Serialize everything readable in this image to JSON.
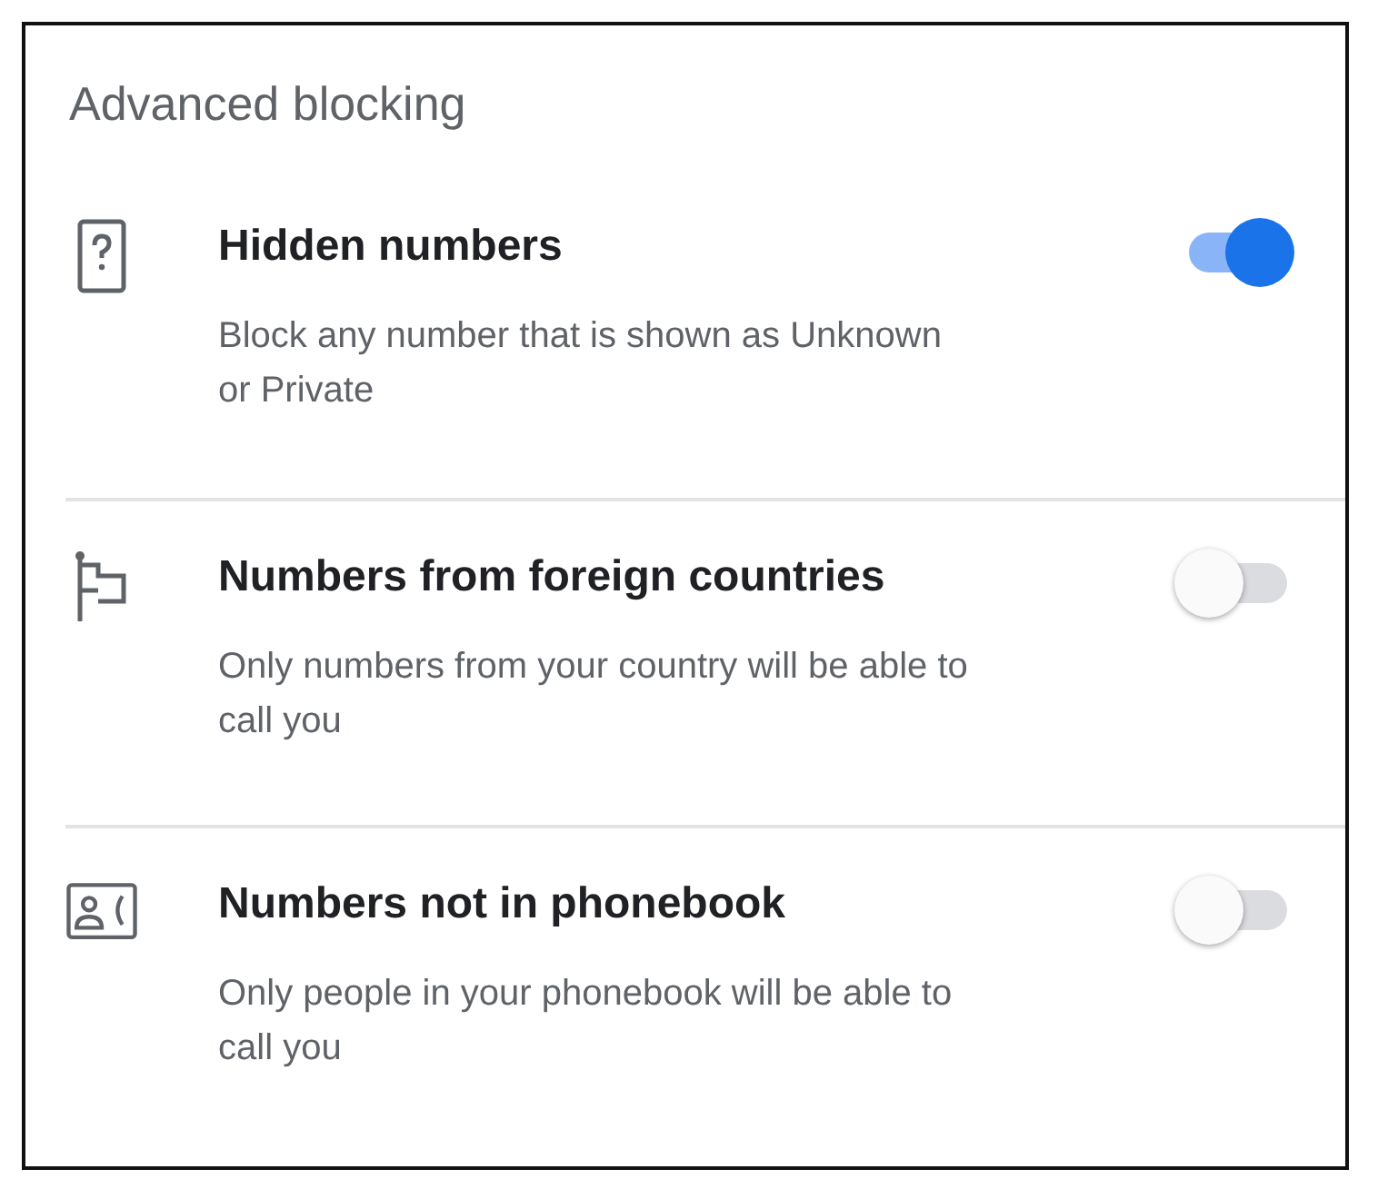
{
  "section": {
    "title": "Advanced blocking"
  },
  "settings": [
    {
      "title": "Hidden numbers",
      "description": "Block any number that is shown as Unknown or Private",
      "on": true
    },
    {
      "title": "Numbers from foreign countries",
      "description": "Only numbers from your country will be able to call you",
      "on": false
    },
    {
      "title": "Numbers not in phonebook",
      "description": "Only people in your phonebook will be able to call you",
      "on": false
    }
  ]
}
